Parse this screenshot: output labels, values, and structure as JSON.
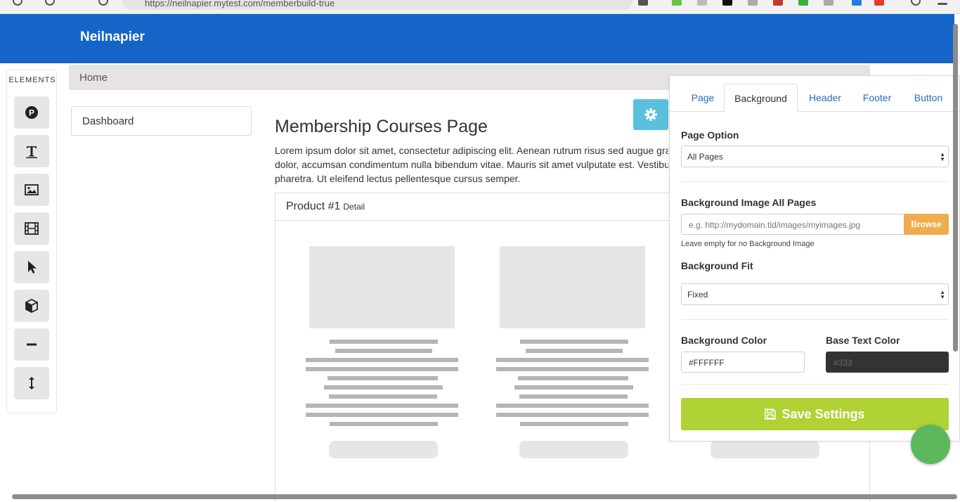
{
  "browser": {
    "url": "https://neilnapier.mytest.com/memberbuild-true"
  },
  "header": {
    "brand": "Neilnapier"
  },
  "elements_panel": {
    "title": "ELEMENTS",
    "items": [
      {
        "name": "paragraph-icon"
      },
      {
        "name": "text-icon"
      },
      {
        "name": "image-icon"
      },
      {
        "name": "video-icon"
      },
      {
        "name": "pointer-icon"
      },
      {
        "name": "cube-icon"
      },
      {
        "name": "divider-icon"
      },
      {
        "name": "spacer-icon"
      }
    ]
  },
  "breadcrumb": {
    "home": "Home"
  },
  "sidenav": {
    "dashboard": "Dashboard"
  },
  "main": {
    "title": "Membership Courses Page",
    "lorem_lines": [
      "Lorem ipsum dolor sit amet, consectetur adipiscing elit. Aenean rutrum risus sed augue gravida, vel",
      "dolor, accumsan condimentum nulla bibendum vitae. Mauris sit amet vulputate est. Vestibulum",
      "pharetra. Ut eleifend lectus pellentesque cursus semper."
    ],
    "product": {
      "name": "Product #1",
      "detail": "Detail"
    }
  },
  "settings_panel": {
    "tabs": [
      "Page",
      "Background",
      "Header",
      "Footer",
      "Button"
    ],
    "active_tab": "Background",
    "page_option_label": "Page Option",
    "page_option_value": "All Pages",
    "bg_image_label": "Background Image All Pages",
    "bg_image_placeholder": "e.g. http://mydomain.tld/images/myimages.jpg",
    "browse_label": "Browse",
    "bg_image_help": "Leave empty for no Background Image",
    "bg_fit_label": "Background Fit",
    "bg_fit_value": "Fixed",
    "bg_color_label": "Background Color",
    "bg_color_value": "#FFFFFF",
    "text_color_label": "Base Text Color",
    "text_color_value": "#333",
    "save_label": "Save Settings"
  },
  "colors": {
    "header_blue": "#1565c8",
    "info_button": "#5bc0de",
    "browse_orange": "#f0ad4e",
    "save_green": "#b0d235",
    "fab_green": "#5cb85c"
  }
}
